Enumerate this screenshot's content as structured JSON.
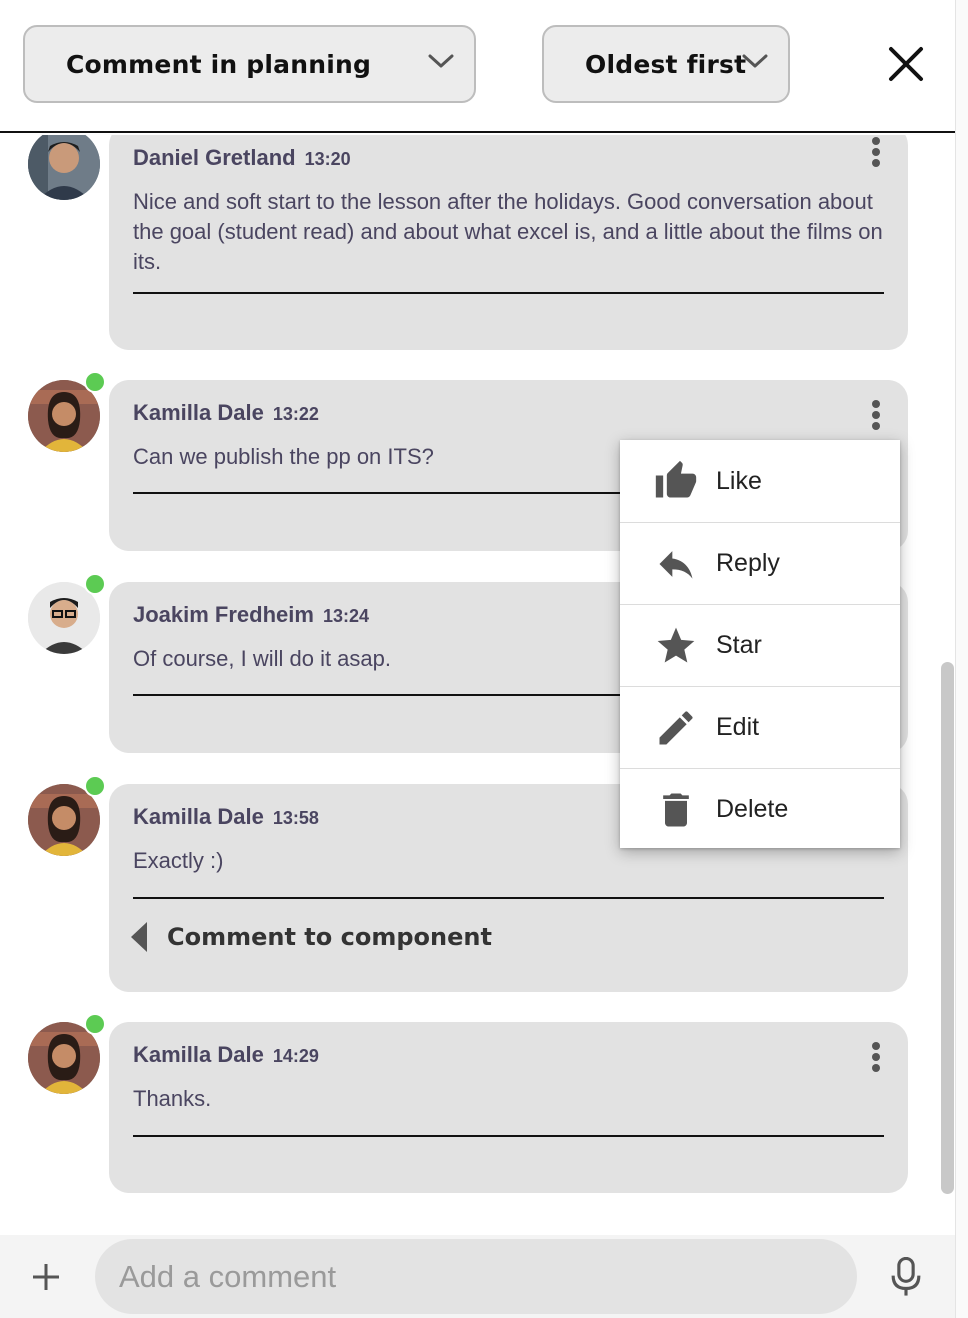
{
  "header": {
    "filter_label": "Comment in planning",
    "sort_label": "Oldest first"
  },
  "comments": [
    {
      "author": "Daniel Gretland",
      "time": "13:20",
      "text": "Nice and soft start to the lesson after the holidays. Good conversation about the goal (student read) and about what excel is, and a little about the films on its.",
      "online": false
    },
    {
      "author": "Kamilla Dale",
      "time": "13:22",
      "text": "Can we publish the pp on ITS?",
      "online": true
    },
    {
      "author": "Joakim Fredheim",
      "time": "13:24",
      "text": "Of course, I will do it asap.",
      "online": true
    },
    {
      "author": "Kamilla Dale",
      "time": "13:58",
      "text": "Exactly :)",
      "online": true,
      "component_link": "Comment to component"
    },
    {
      "author": "Kamilla Dale",
      "time": "14:29",
      "text": "Thanks.",
      "online": true
    }
  ],
  "context_menu": {
    "items": [
      {
        "label": "Like",
        "icon": "thumb-up-icon"
      },
      {
        "label": "Reply",
        "icon": "reply-icon"
      },
      {
        "label": "Star",
        "icon": "star-icon"
      },
      {
        "label": "Edit",
        "icon": "pencil-icon"
      },
      {
        "label": "Delete",
        "icon": "trash-icon"
      }
    ]
  },
  "composer": {
    "placeholder": "Add a comment"
  },
  "colors": {
    "card_background": "#e2e2e2",
    "online_dot": "#5ccb53",
    "author_text": "#4a4560",
    "icon_gray": "#555555"
  }
}
